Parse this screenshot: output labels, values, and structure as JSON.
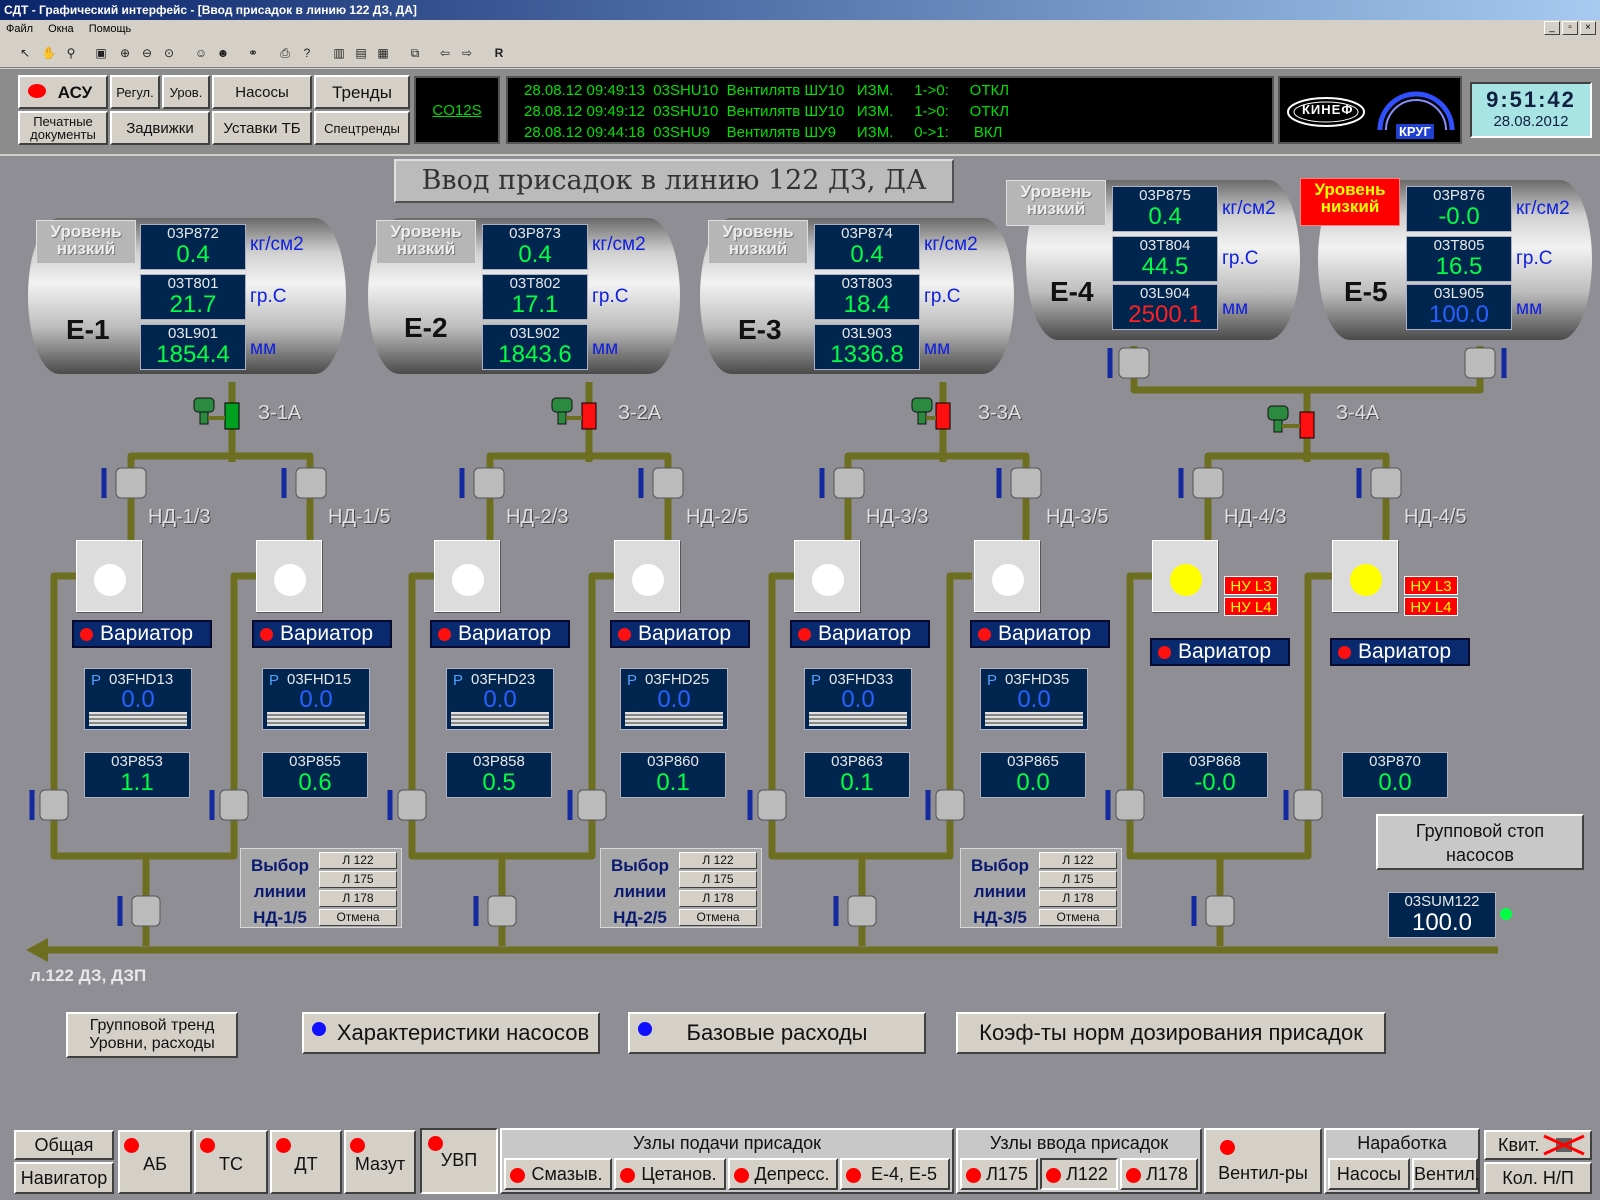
{
  "window": {
    "title": "СДТ - Графический интерфейс - [Ввод присадок в линию 122 ДЗ, ДА]",
    "menu": [
      "Файл",
      "Окна",
      "Помощь"
    ]
  },
  "header": {
    "buttons": {
      "asu": "АСУ",
      "regul": "Регул.",
      "urov": "Уров.",
      "pumps": "Насосы",
      "trends": "Тренды",
      "print1": "Печатные",
      "print2": "документы",
      "valves": "Задвижки",
      "settings": "Уставки ТБ",
      "spectrends": "Спецтренды"
    },
    "co": "CO12S",
    "messages": [
      "28.08.12 09:49:13  03SHU10  Вентилятв ШУ10   ИЗМ.     1->0:     ОТКЛ",
      "28.08.12 09:49:12  03SHU10  Вентилятв ШУ10   ИЗМ.     1->0:     ОТКЛ",
      "28.08.12 09:44:18  03SHU9    Вентилятв ШУ9     ИЗМ.     0->1:      ВКЛ"
    ],
    "logo1": "КИНЕФ",
    "logo2": "КРУГ",
    "time": "9:51:42",
    "date": "28.08.2012"
  },
  "page_title": "Ввод присадок в линию 122 ДЗ, ДА",
  "tanks": [
    {
      "name": "Е-1",
      "level": "Уровень низкий",
      "alarm": false,
      "p_tag": "03P872",
      "p": "0.4",
      "t_tag": "03T801",
      "t": "21.7",
      "l_tag": "03L901",
      "l": "1854.4",
      "l_color": "green"
    },
    {
      "name": "Е-2",
      "level": "Уровень низкий",
      "alarm": false,
      "p_tag": "03P873",
      "p": "0.4",
      "t_tag": "03T802",
      "t": "17.1",
      "l_tag": "03L902",
      "l": "1843.6",
      "l_color": "green"
    },
    {
      "name": "Е-3",
      "level": "Уровень низкий",
      "alarm": false,
      "p_tag": "03P874",
      "p": "0.4",
      "t_tag": "03T803",
      "t": "18.4",
      "l_tag": "03L903",
      "l": "1336.8",
      "l_color": "green"
    },
    {
      "name": "Е-4",
      "level": "Уровень низкий",
      "alarm": false,
      "p_tag": "03P875",
      "p": "0.4",
      "t_tag": "03T804",
      "t": "44.5",
      "l_tag": "03L904",
      "l": "2500.1",
      "l_color": "red"
    },
    {
      "name": "Е-5",
      "level": "Уровень низкий",
      "alarm": true,
      "p_tag": "03P876",
      "p": "-0.0",
      "t_tag": "03T805",
      "t": "16.5",
      "l_tag": "03L905",
      "l": "100.0",
      "l_color": "blue"
    }
  ],
  "units": {
    "p": "кг/см2",
    "t": "гр.С",
    "l": "мм"
  },
  "valves": [
    "З-1А",
    "З-2А",
    "З-3А",
    "З-4А"
  ],
  "pumps": [
    {
      "name": "НД-1/3",
      "on": false,
      "variator": "Вариатор",
      "fhd_p": "P",
      "fhd_tag": "03FHD13",
      "fhd": "0.0",
      "p_tag": "03P853",
      "p": "1.1"
    },
    {
      "name": "НД-1/5",
      "on": false,
      "variator": "Вариатор",
      "fhd_p": "P",
      "fhd_tag": "03FHD15",
      "fhd": "0.0",
      "p_tag": "03P855",
      "p": "0.6"
    },
    {
      "name": "НД-2/3",
      "on": false,
      "variator": "Вариатор",
      "fhd_p": "P",
      "fhd_tag": "03FHD23",
      "fhd": "0.0",
      "p_tag": "03P858",
      "p": "0.5"
    },
    {
      "name": "НД-2/5",
      "on": false,
      "variator": "Вариатор",
      "fhd_p": "P",
      "fhd_tag": "03FHD25",
      "fhd": "0.0",
      "p_tag": "03P860",
      "p": "0.1"
    },
    {
      "name": "НД-3/3",
      "on": false,
      "variator": "Вариатор",
      "fhd_p": "P",
      "fhd_tag": "03FHD33",
      "fhd": "0.0",
      "p_tag": "03P863",
      "p": "0.1"
    },
    {
      "name": "НД-3/5",
      "on": false,
      "variator": "Вариатор",
      "fhd_p": "P",
      "fhd_tag": "03FHD35",
      "fhd": "0.0",
      "p_tag": "03P865",
      "p": "0.0"
    },
    {
      "name": "НД-4/3",
      "on": true,
      "variator": "Вариатор",
      "nu1": "НУ L3",
      "nu2": "НУ L4",
      "p_tag": "03P868",
      "p": "-0.0"
    },
    {
      "name": "НД-4/5",
      "on": true,
      "variator": "Вариатор",
      "nu1": "НУ L3",
      "nu2": "НУ L4",
      "p_tag": "03P870",
      "p": "0.0"
    }
  ],
  "line_select": [
    {
      "l1": "Выбор",
      "l2": "линии",
      "l3": "НД-1/5",
      "opts": [
        "Л 122",
        "Л 175",
        "Л 178",
        "Отмена"
      ]
    },
    {
      "l1": "Выбор",
      "l2": "линии",
      "l3": "НД-2/5",
      "opts": [
        "Л 122",
        "Л 175",
        "Л 178",
        "Отмена"
      ]
    },
    {
      "l1": "Выбор",
      "l2": "линии",
      "l3": "НД-3/5",
      "opts": [
        "Л 122",
        "Л 175",
        "Л 178",
        "Отмена"
      ]
    }
  ],
  "group_stop": {
    "l1": "Групповой стоп",
    "l2": "насосов"
  },
  "sum": {
    "tag": "03SUM122",
    "value": "100.0"
  },
  "line_label": "л.122 ДЗ, ДЗП",
  "bottom_buttons": {
    "trend1": "Групповой тренд",
    "trend2": "Уровни, расходы",
    "pump_char": "Характеристики насосов",
    "base": "Базовые расходы",
    "coef": "Коэф-ты норм дозирования присадок"
  },
  "nav": {
    "general": "Общая",
    "navigator": "Навигатор",
    "ab": "АБ",
    "ts": "ТС",
    "dt": "ДТ",
    "mazut": "Мазут",
    "uvp": "УВП",
    "feed_title": "Узлы подачи присадок",
    "feed": [
      "Смазыв.",
      "Цетанов.",
      "Депресс.",
      "Е-4, Е-5"
    ],
    "input_title": "Узлы ввода присадок",
    "input": [
      "Л175",
      "Л122",
      "Л178"
    ],
    "vent": "Вентил-ры",
    "run_title": "Наработка",
    "run": [
      "Насосы",
      "Вентил."
    ],
    "kvit": "Квит.",
    "kol": "Кол. Н/П"
  },
  "colors": {
    "pipe": "#7a7a28",
    "alarm": "#ff0000",
    "value": "#00ff44",
    "panel": "#002650"
  }
}
